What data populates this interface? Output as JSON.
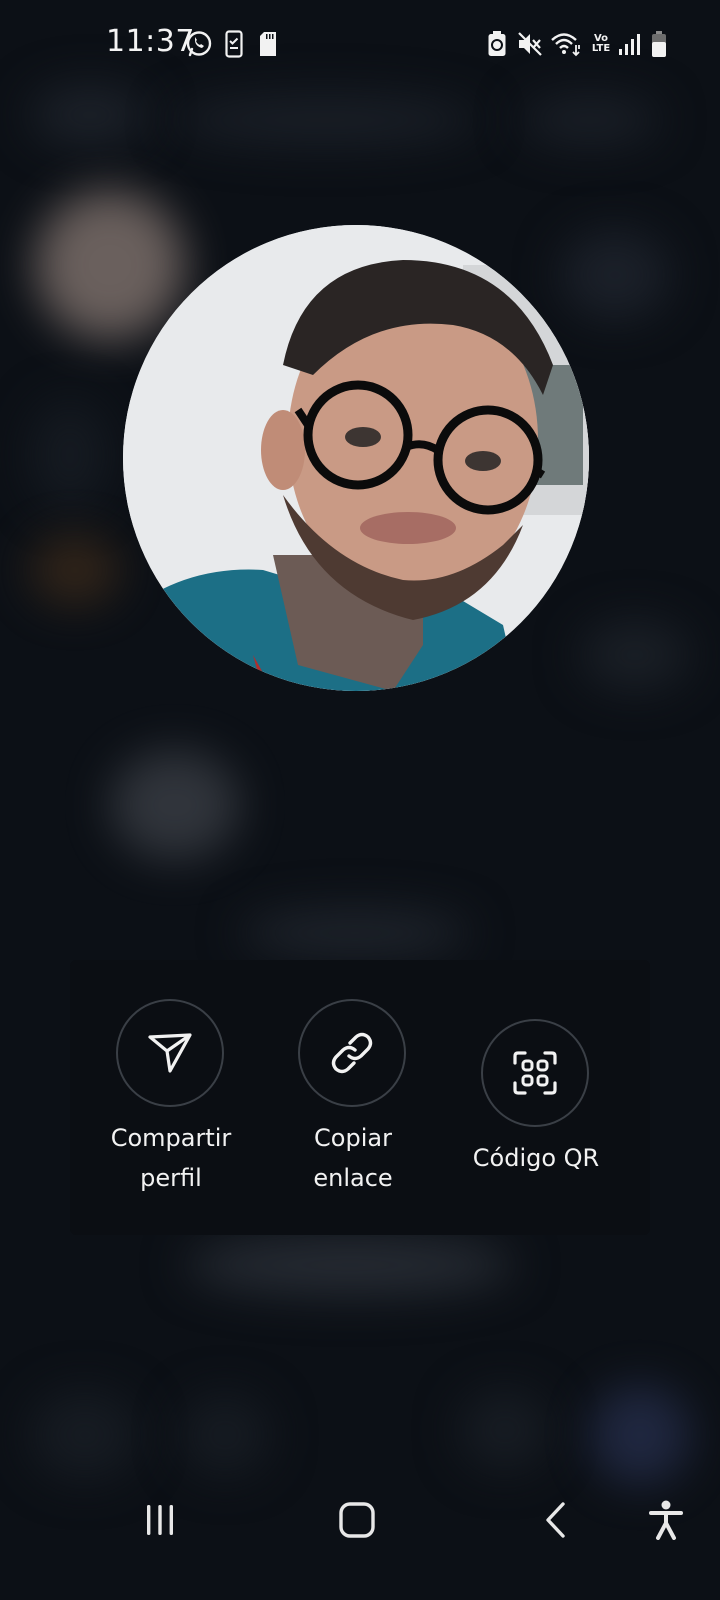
{
  "status_bar": {
    "time": "11:37",
    "left_icons": [
      "whatsapp-icon",
      "phone-checklist-icon",
      "sd-card-icon"
    ],
    "right_icons": [
      "battery-saver-icon",
      "mute-icon",
      "wifi-icon",
      "volte-icon",
      "signal-icon",
      "battery-icon"
    ],
    "volte_top": "Vo",
    "volte_bottom": "LTE"
  },
  "profile_photo": {
    "description_icon": "profile-avatar"
  },
  "actions": [
    {
      "label_line1": "Compartir",
      "label_line2": "perfil",
      "icon": "send-icon"
    },
    {
      "label_line1": "Copiar",
      "label_line2": "enlace",
      "icon": "link-icon"
    },
    {
      "label_line1": "Código QR",
      "label_line2": "",
      "icon": "qr-code-icon"
    }
  ],
  "nav_bar": {
    "icons": [
      "recents-icon",
      "home-icon",
      "back-icon",
      "accessibility-icon"
    ]
  }
}
